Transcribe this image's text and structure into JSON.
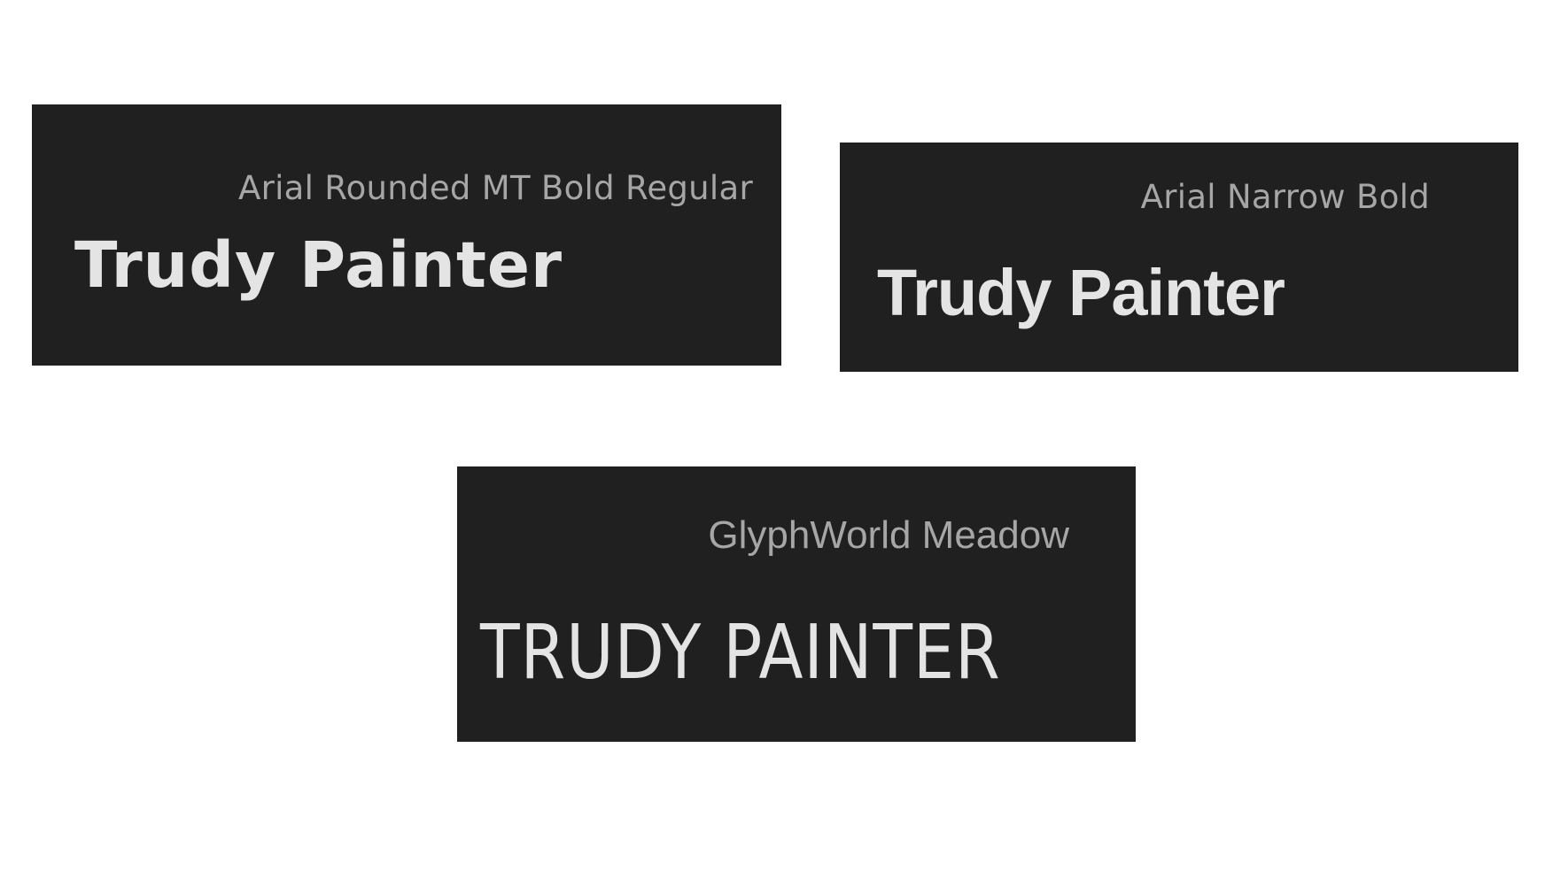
{
  "cards": [
    {
      "font_name": "Arial Rounded MT Bold Regular",
      "sample_text": "Trudy Painter"
    },
    {
      "font_name": "Arial Narrow Bold",
      "sample_text": "Trudy Painter"
    },
    {
      "font_name": "GlyphWorld Meadow",
      "sample_text": "TRUDY PAINTER"
    }
  ],
  "colors": {
    "background": "#ffffff",
    "card_background": "#202020",
    "font_name_text": "#a6a6a6",
    "sample_text": "#e4e4e4"
  }
}
